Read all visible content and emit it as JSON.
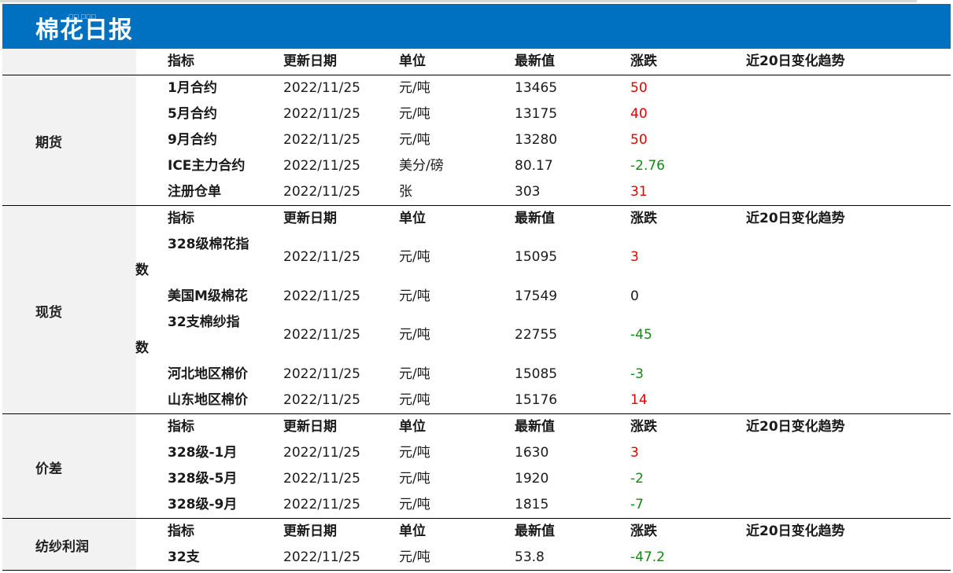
{
  "report": {
    "title": "棉花日报",
    "banner_tiny_text": "□□ □□□"
  },
  "headers": {
    "name": "指标",
    "date": "更新日期",
    "unit": "单位",
    "value": "最新值",
    "change": "涨跌",
    "trend": "近20日变化趋势"
  },
  "sections": {
    "futures": {
      "label": "期货",
      "rows": [
        {
          "name": "1月合约",
          "date": "2022/11/25",
          "unit": "元/吨",
          "value": "13465",
          "change": "50"
        },
        {
          "name": "5月合约",
          "date": "2022/11/25",
          "unit": "元/吨",
          "value": "13175",
          "change": "40"
        },
        {
          "name": "9月合约",
          "date": "2022/11/25",
          "unit": "元/吨",
          "value": "13280",
          "change": "50"
        },
        {
          "name": "ICE主力合约",
          "date": "2022/11/25",
          "unit": "美分/磅",
          "value": "80.17",
          "change": "-2.76"
        },
        {
          "name": "注册仓单",
          "date": "2022/11/25",
          "unit": "张",
          "value": "303",
          "change": "31"
        }
      ]
    },
    "spot": {
      "label": "现货",
      "rows": [
        {
          "name_head": "328级棉花指",
          "name_tail": "数",
          "date": "2022/11/25",
          "unit": "元/吨",
          "value": "15095",
          "change": "3"
        },
        {
          "name": "美国M级棉花",
          "date": "2022/11/25",
          "unit": "元/吨",
          "value": "17549",
          "change": "0"
        },
        {
          "name_head": "32支棉纱指",
          "name_tail": "数",
          "date": "2022/11/25",
          "unit": "元/吨",
          "value": "22755",
          "change": "-45"
        },
        {
          "name": "河北地区棉价",
          "date": "2022/11/25",
          "unit": "元/吨",
          "value": "15085",
          "change": "-3"
        },
        {
          "name": "山东地区棉价",
          "date": "2022/11/25",
          "unit": "元/吨",
          "value": "15176",
          "change": "14"
        }
      ]
    },
    "spread": {
      "label": "价差",
      "rows": [
        {
          "name": "328级-1月",
          "date": "2022/11/25",
          "unit": "元/吨",
          "value": "1630",
          "change": "3"
        },
        {
          "name": "328级-5月",
          "date": "2022/11/25",
          "unit": "元/吨",
          "value": "1920",
          "change": "-2"
        },
        {
          "name": "328级-9月",
          "date": "2022/11/25",
          "unit": "元/吨",
          "value": "1815",
          "change": "-7"
        }
      ]
    },
    "profit": {
      "label": "纺纱利润",
      "rows": [
        {
          "name": "32支",
          "date": "2022/11/25",
          "unit": "元/吨",
          "value": "53.8",
          "change": "-47.2"
        }
      ]
    }
  },
  "colors": {
    "banner": "#0070c0",
    "up": "#e00000",
    "down": "#108a10",
    "sidebar": "#f2f2f2"
  }
}
